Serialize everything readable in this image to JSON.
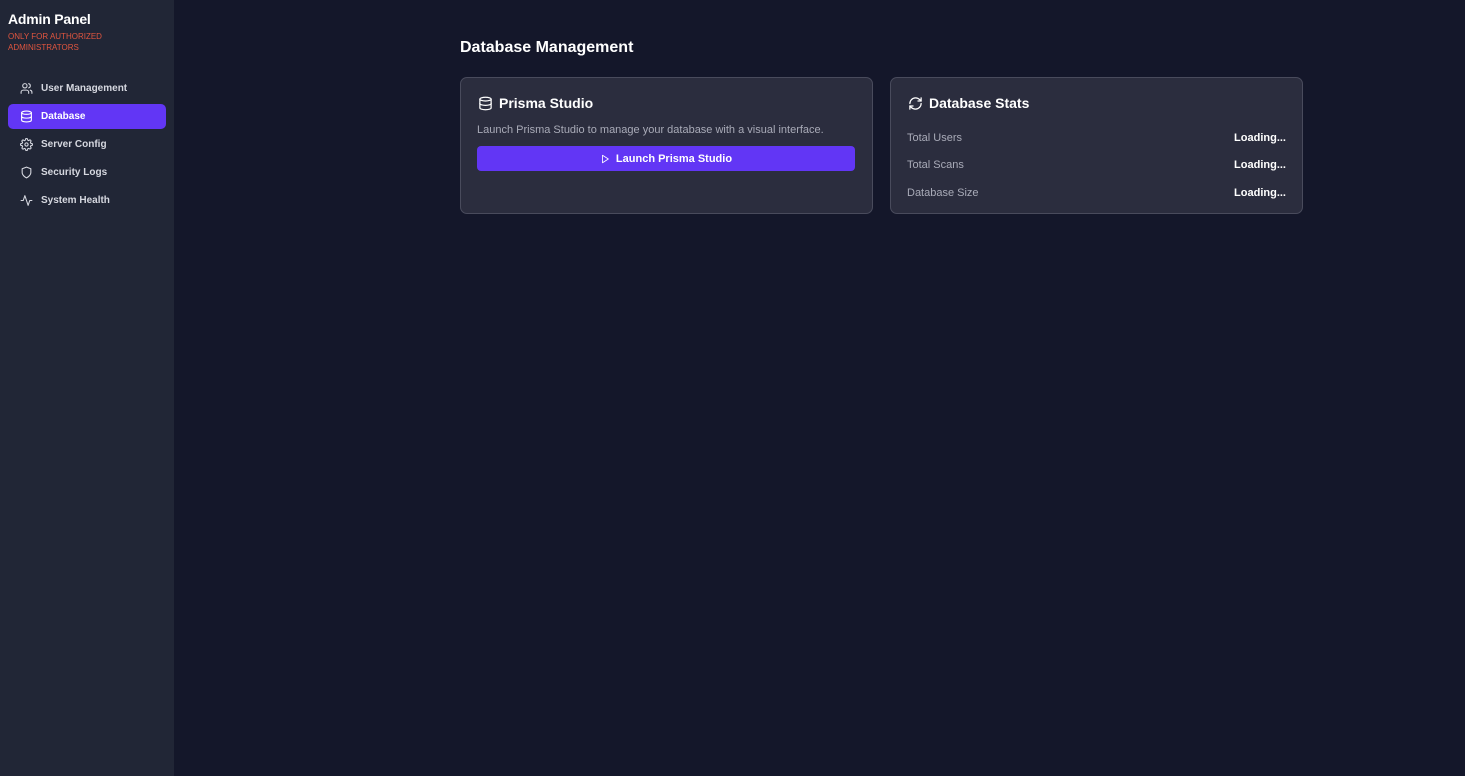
{
  "sidebar": {
    "title": "Admin Panel",
    "warning": "ONLY FOR AUTHORIZED ADMINISTRATORS",
    "items": [
      {
        "label": "User Management",
        "icon": "users-icon",
        "active": false
      },
      {
        "label": "Database",
        "icon": "database-icon",
        "active": true
      },
      {
        "label": "Server Config",
        "icon": "gear-icon",
        "active": false
      },
      {
        "label": "Security Logs",
        "icon": "shield-icon",
        "active": false
      },
      {
        "label": "System Health",
        "icon": "activity-icon",
        "active": false
      }
    ]
  },
  "main": {
    "title": "Database Management",
    "prisma_card": {
      "title": "Prisma Studio",
      "icon": "database-icon",
      "description": "Launch Prisma Studio to manage your database with a visual interface.",
      "button_label": "Launch Prisma Studio",
      "button_icon": "play-icon"
    },
    "stats_card": {
      "title": "Database Stats",
      "icon": "refresh-icon",
      "rows": [
        {
          "label": "Total Users",
          "value": "Loading..."
        },
        {
          "label": "Total Scans",
          "value": "Loading..."
        },
        {
          "label": "Database Size",
          "value": "Loading..."
        }
      ]
    }
  },
  "colors": {
    "background": "#14172a",
    "sidebar": "#212636",
    "accent": "#6236f5",
    "card": "#2b2d3e",
    "warning": "#e0553f"
  }
}
